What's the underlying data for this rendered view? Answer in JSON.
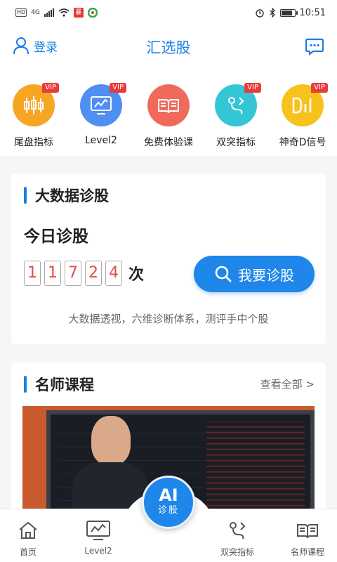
{
  "status_bar": {
    "hd": "HD",
    "network": "4G",
    "notif": "暴",
    "time": "10:51",
    "battery_level": 0.85
  },
  "header": {
    "login_label": "登录",
    "title": "汇选股"
  },
  "features": [
    {
      "label": "尾盘指标",
      "vip": "VIP",
      "color": "#f5a623",
      "icon": "candlestick-icon"
    },
    {
      "label": "Level2",
      "vip": "VIP",
      "color": "#4f8ff2",
      "icon": "monitor-chart-icon"
    },
    {
      "label": "免费体验课",
      "vip": "",
      "color": "#ef6a5b",
      "icon": "book-icon"
    },
    {
      "label": "双突指标",
      "vip": "VIP",
      "color": "#35c6d6",
      "icon": "route-icon"
    },
    {
      "label": "神奇D信号",
      "vip": "VIP",
      "color": "#f7c21c",
      "icon": "d-signal-icon"
    }
  ],
  "diagnose": {
    "title": "大数据诊股",
    "today_label": "今日诊股",
    "digits": [
      "1",
      "1",
      "7",
      "2",
      "4"
    ],
    "unit": "次",
    "button_label": "我要诊股",
    "description": "大数据透视，六维诊断体系，测评手中个股"
  },
  "courses": {
    "title": "名师课程",
    "see_all": "查看全部 >"
  },
  "bottom_nav": {
    "items": [
      {
        "label": "首页",
        "icon": "home-icon"
      },
      {
        "label": "Level2",
        "icon": "monitor-chart-icon"
      },
      {
        "label": "双突指标",
        "icon": "route-icon"
      },
      {
        "label": "名师课程",
        "icon": "book-icon"
      }
    ],
    "ai": {
      "main": "AI",
      "sub": "诊股"
    }
  },
  "colors": {
    "accent": "#1a7ee6",
    "vip": "#ea3b3b",
    "digit": "#e54b4b"
  }
}
